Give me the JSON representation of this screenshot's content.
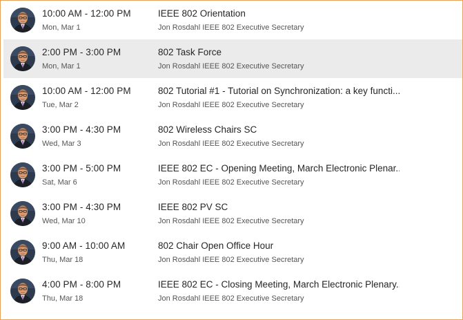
{
  "meetings": [
    {
      "time": "10:00 AM - 12:00 PM",
      "date": "Mon, Mar 1",
      "title": "IEEE 802 Orientation",
      "host": "Jon Rosdahl IEEE 802 Executive Secretary",
      "selected": false
    },
    {
      "time": "2:00 PM - 3:00 PM",
      "date": "Mon, Mar 1",
      "title": "802 Task Force",
      "host": "Jon Rosdahl IEEE 802 Executive Secretary",
      "selected": true
    },
    {
      "time": "10:00 AM - 12:00 PM",
      "date": "Tue, Mar 2",
      "title": "802 Tutorial #1 - Tutorial on Synchronization: a key functi...",
      "host": "Jon Rosdahl IEEE 802 Executive Secretary",
      "selected": false
    },
    {
      "time": "3:00 PM - 4:30 PM",
      "date": "Wed, Mar 3",
      "title": "802 Wireless Chairs SC",
      "host": "Jon Rosdahl IEEE 802 Executive Secretary",
      "selected": false
    },
    {
      "time": "3:00 PM - 5:00 PM",
      "date": "Sat, Mar 6",
      "title": "IEEE 802 EC - Opening Meeting, March Electronic Plenar...",
      "host": "Jon Rosdahl IEEE 802 Executive Secretary",
      "selected": false
    },
    {
      "time": "3:00 PM - 4:30 PM",
      "date": "Wed, Mar 10",
      "title": "IEEE 802 PV SC",
      "host": "Jon Rosdahl IEEE 802 Executive Secretary",
      "selected": false
    },
    {
      "time": "9:00 AM - 10:00 AM",
      "date": "Thu, Mar 18",
      "title": "802 Chair Open Office Hour",
      "host": "Jon Rosdahl IEEE 802 Executive Secretary",
      "selected": false
    },
    {
      "time": "4:00 PM - 8:00 PM",
      "date": "Thu, Mar 18",
      "title": "IEEE 802 EC - Closing Meeting, March Electronic Plenary...",
      "host": "Jon Rosdahl IEEE 802 Executive Secretary",
      "selected": false
    }
  ],
  "icons": {
    "avatar": "host-avatar-icon"
  },
  "colors": {
    "border": "#e8a15a",
    "selected_row": "#ebebeb",
    "text_primary": "#262626",
    "text_secondary": "#555555"
  }
}
